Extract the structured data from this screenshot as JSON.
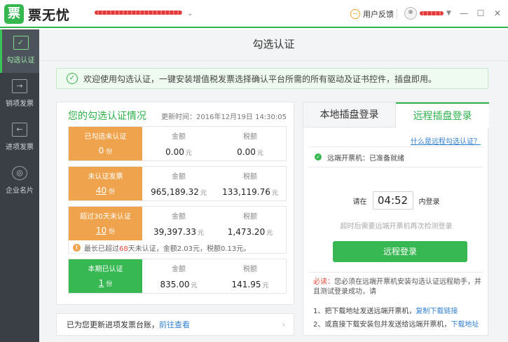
{
  "app": {
    "logo_glyph": "票",
    "name": "票无忧",
    "feedback": "用户反馈",
    "minimize": "—",
    "maximize": "☐",
    "close": "✕"
  },
  "sidebar": {
    "items": [
      {
        "label": "勾选认证",
        "active": true
      },
      {
        "label": "销项发票",
        "active": false
      },
      {
        "label": "进项发票",
        "active": false
      },
      {
        "label": "企业名片",
        "active": false
      }
    ]
  },
  "main": {
    "title": "勾选认证",
    "notice": "欢迎使用勾选认证，一键安装增值税发票选择确认平台所需的所有驱动及证书控件，插盘即用。"
  },
  "summary": {
    "title": "您的勾选认证情况",
    "update_time": "更新时间：2016年12月19日 14:30:05",
    "amount_label": "金额",
    "tax_label": "税额",
    "count_unit": "份",
    "money_unit": "元",
    "rows": [
      {
        "label": "已勾选未认证",
        "count": "0",
        "amount": "0.00",
        "tax": "0.00"
      },
      {
        "label": "未认证发票",
        "count": "40",
        "amount": "965,189.32",
        "tax": "133,119.76"
      },
      {
        "label": "超过30天未认证",
        "count": "10",
        "amount": "39,397.33",
        "tax": "1,473.20"
      },
      {
        "label": "本期已认证",
        "count": "1",
        "amount": "835.00",
        "tax": "141.95"
      }
    ],
    "warning_prefix": "最长已超过",
    "warning_days": "68",
    "warning_suffix": "天未认证，金额2.03元，税额0.13元。"
  },
  "ledger_bar": {
    "text": "已为您更新进项发票台账，",
    "link": "前往查看",
    "chevron": "›"
  },
  "login_panel": {
    "tab_local": "本地插盘登录",
    "tab_remote": "远程插盘登录",
    "what_link": "什么是远程勾选认证？",
    "status": "远端开票机：已准备就绪",
    "please": "请在",
    "time": "04:52",
    "within": "内登录",
    "hint": "超时后需要远端开票机再次检测登录",
    "button": "远程登录",
    "must_label": "必读：",
    "must_text": "您必须在远端开票机安装勾选认证远程助手，并且测试登录成功，请",
    "step1_text": "1、把下载地址发送远端开票机，",
    "step1_link": "复制下载链接",
    "step2_text": "2、或直接下载安装包并发送给远端开票机，",
    "step2_link": "下载地址"
  }
}
